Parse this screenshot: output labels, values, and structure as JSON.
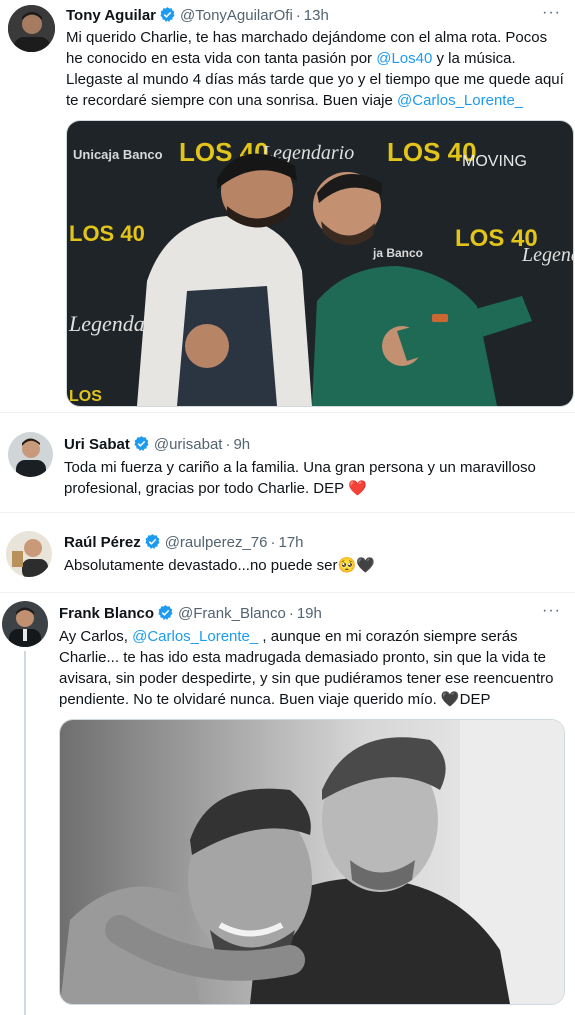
{
  "tweets": [
    {
      "name": "Tony Aguilar",
      "handle": "@TonyAguilarOfi",
      "time": "13h",
      "text_a": "Mi querido Charlie, te has marchado dejándome con el alma rota. Pocos he conocido en esta vida con tanta pasión por ",
      "link1": "@Los40",
      "text_b": " y la música. Llegaste al mundo 4 días más tarde que yo y el tiempo que me quede aquí te recordaré siempre con una sonrisa. Buen viaje ",
      "link2": "@Carlos_Lorente_",
      "backdrop": {
        "sponsor": "Unicaja Banco",
        "brand": "LOS 40",
        "legendario": "Legendario",
        "moving": "MOVING",
        "banco": "ja Banco",
        "legenda": "Legenda",
        "legend_right": "Legend",
        "los_small": "LOS"
      }
    },
    {
      "name": "Uri Sabat",
      "handle": "@urisabat",
      "time": "9h",
      "text": "Toda mi fuerza y cariño a la familia. Una gran persona y un maravilloso profesional, gracias por todo Charlie. DEP ",
      "emoji": "❤️"
    },
    {
      "name": "Raúl Pérez",
      "handle": "@raulperez_76",
      "time": "17h",
      "text": "Absolutamente devastado...no puede ser",
      "emoji": "🥺🖤"
    },
    {
      "name": "Frank Blanco",
      "handle": "@Frank_Blanco",
      "time": "19h",
      "text_a": "Ay Carlos, ",
      "link1": "@Carlos_Lorente_",
      "text_b": " , aunque en mi corazón siempre serás Charlie... te has ido esta madrugada demasiado pronto, sin que la vida te avisara, sin poder despedirte, y sin que pudiéramos tener ese reencuentro pendiente. No te olvidaré nunca. Buen viaje querido mío. ",
      "emoji": "🖤",
      "text_c": "DEP"
    }
  ],
  "more_label": "···",
  "separator": "·",
  "colors": {
    "link": "#1d9bf0",
    "verified": "#1d9bf0",
    "heart": "#e0245e"
  },
  "icons": {
    "verified": "verified-badge-icon",
    "more": "more-options-icon"
  }
}
